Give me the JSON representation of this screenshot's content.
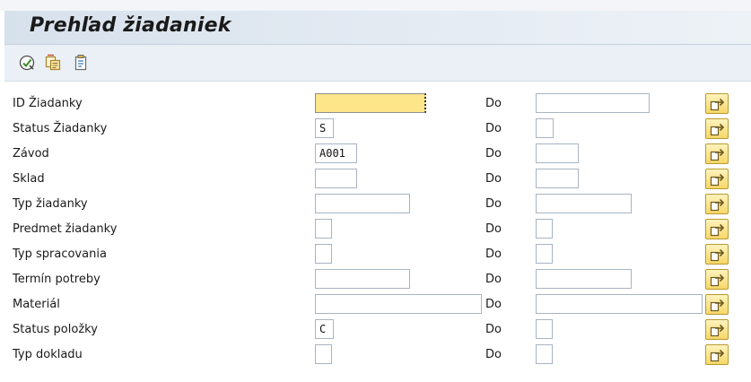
{
  "window": {
    "title": "Prehľad žiadaniek"
  },
  "toolbar": {
    "icons": [
      "execute-icon",
      "copy-variant-icon",
      "selection-options-icon"
    ]
  },
  "range_label": "Do",
  "fields": [
    {
      "label": "ID Žiadanky",
      "low_value": "",
      "high_value": ""
    },
    {
      "label": "Status Žiadanky",
      "low_value": "S",
      "high_value": ""
    },
    {
      "label": "Závod",
      "low_value": "A001",
      "high_value": ""
    },
    {
      "label": "Sklad",
      "low_value": "",
      "high_value": ""
    },
    {
      "label": "Typ žiadanky",
      "low_value": "",
      "high_value": ""
    },
    {
      "label": "Predmet žiadanky",
      "low_value": "",
      "high_value": ""
    },
    {
      "label": "Typ spracovania",
      "low_value": "",
      "high_value": ""
    },
    {
      "label": "Termín potreby",
      "low_value": "",
      "high_value": ""
    },
    {
      "label": "Materiál",
      "low_value": "",
      "high_value": ""
    },
    {
      "label": "Status položky",
      "low_value": "C",
      "high_value": ""
    },
    {
      "label": "Typ dokladu",
      "low_value": "",
      "high_value": ""
    }
  ],
  "colors": {
    "focused_field": "#fde58a",
    "multiple_selection_button": "#f6d769",
    "title_bar": "#d7e1ec"
  }
}
